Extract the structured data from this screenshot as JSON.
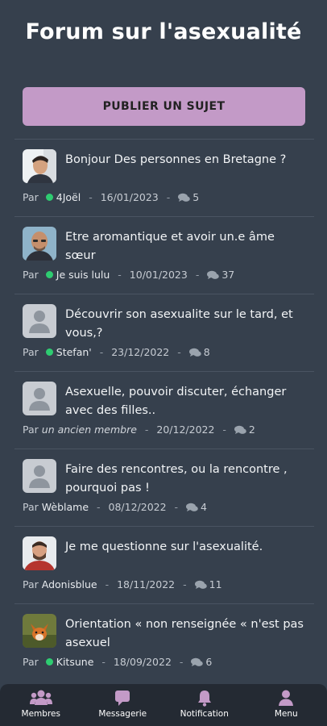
{
  "header": {
    "title": "Forum sur l'asexualité"
  },
  "actions": {
    "publish_label": "PUBLIER UN SUJET"
  },
  "meta_prefix": "Par",
  "topics": [
    {
      "title": "Bonjour Des personnes en Bretagne ?",
      "author": "4Joël",
      "online": true,
      "date": "16/01/2023",
      "replies": "5",
      "avatar": "photo-young-man-icon"
    },
    {
      "title": "Etre aromantique et avoir un.e âme sœur",
      "author": "Je suis lulu",
      "online": true,
      "date": "10/01/2023",
      "replies": "37",
      "avatar": "photo-bald-man-icon"
    },
    {
      "title": "Découvrir son asexualite sur le tard, et vous,?",
      "author": "Stefan'",
      "online": true,
      "date": "23/12/2022",
      "replies": "8",
      "avatar": "default-user-icon"
    },
    {
      "title": "Asexuelle, pouvoir discuter, échanger avec des filles..",
      "author": "un ancien membre",
      "online": false,
      "date": "20/12/2022",
      "replies": "2",
      "avatar": "default-user-icon"
    },
    {
      "title": "Faire des rencontres, ou la rencontre , pourquoi pas !",
      "author": "Wèblame",
      "online": false,
      "date": "08/12/2022",
      "replies": "4",
      "avatar": "default-user-icon"
    },
    {
      "title": "Je me questionne sur l'asexualité.",
      "author": "Adonisblue",
      "online": false,
      "date": "18/11/2022",
      "replies": "11",
      "avatar": "photo-bearded-man-icon"
    },
    {
      "title": "Orientation « non renseignée « n'est pas asexuel",
      "author": "Kitsune",
      "online": true,
      "date": "18/09/2022",
      "replies": "6",
      "avatar": "photo-fox-icon"
    }
  ],
  "nav": {
    "members": "Membres",
    "messaging": "Messagerie",
    "notification": "Notification",
    "menu": "Menu"
  },
  "colors": {
    "background": "#36404d",
    "publish_button": "#c39ac7",
    "online_dot": "#2ecc71",
    "nav_background": "#242a33"
  }
}
